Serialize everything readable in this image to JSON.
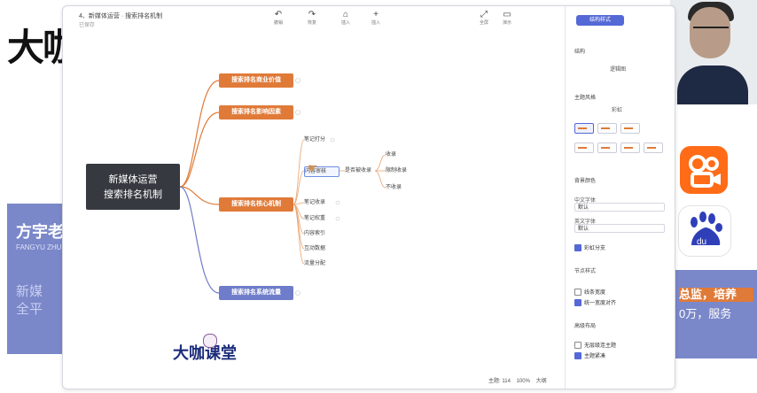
{
  "background": {
    "logo": "大咖",
    "panel_name": "方宇老",
    "panel_sub": "FANGYU ZHUI",
    "panel_text": [
      "新媒",
      "全平"
    ],
    "right_lines": [
      "总监，培养",
      "0万，服务"
    ]
  },
  "window": {
    "title": "4、新媒体运营 · 搜索排名机制",
    "subtitle": "已保存",
    "tools": [
      {
        "icon": "↶",
        "label": "撤销"
      },
      {
        "icon": "↷",
        "label": "恢复"
      },
      {
        "icon": "⌂",
        "label": "插入"
      },
      {
        "icon": "+",
        "label": "插入"
      }
    ],
    "right_tools": [
      {
        "icon": "⤢",
        "label": "全屏"
      },
      {
        "icon": "▭",
        "label": "演示"
      }
    ]
  },
  "mindmap": {
    "root": [
      "新媒体运营",
      "搜索排名机制"
    ],
    "branches": [
      {
        "label": "搜索排名商业价值"
      },
      {
        "label": "搜索排名影响因素"
      },
      {
        "label": "搜索排名核心机制"
      },
      {
        "label": "搜索排名系统流量"
      }
    ],
    "core_children": [
      "笔记打分",
      "内容审核",
      "笔记收录",
      "笔记权重",
      "内容索引",
      "互动数据",
      "流量分配"
    ],
    "decision": "是否被收录",
    "decision_children": [
      "收录",
      "限制收录",
      "不收录"
    ]
  },
  "brand": "大咖课堂",
  "sidebar": {
    "tab": "结构样式",
    "section_layout": "结构",
    "layout_value": "逻辑图",
    "section_theme": "主题风格",
    "theme_value": "彩虹",
    "section_bg": "背景颜色",
    "font_label_1": "中文字体",
    "font_value_1": "默认",
    "font_label_2": "英文字体",
    "font_value_2": "默认",
    "rainbow": "彩虹分支",
    "section_style": "节点样式",
    "style_options": [
      "线条宽度",
      "统一宽度对齐"
    ],
    "section_more": "高级布局",
    "more_options": [
      "无层级连主题",
      "主题紧凑"
    ]
  },
  "status": {
    "topics": "主题: 114",
    "zoom": "100%",
    "size": "大纲"
  }
}
